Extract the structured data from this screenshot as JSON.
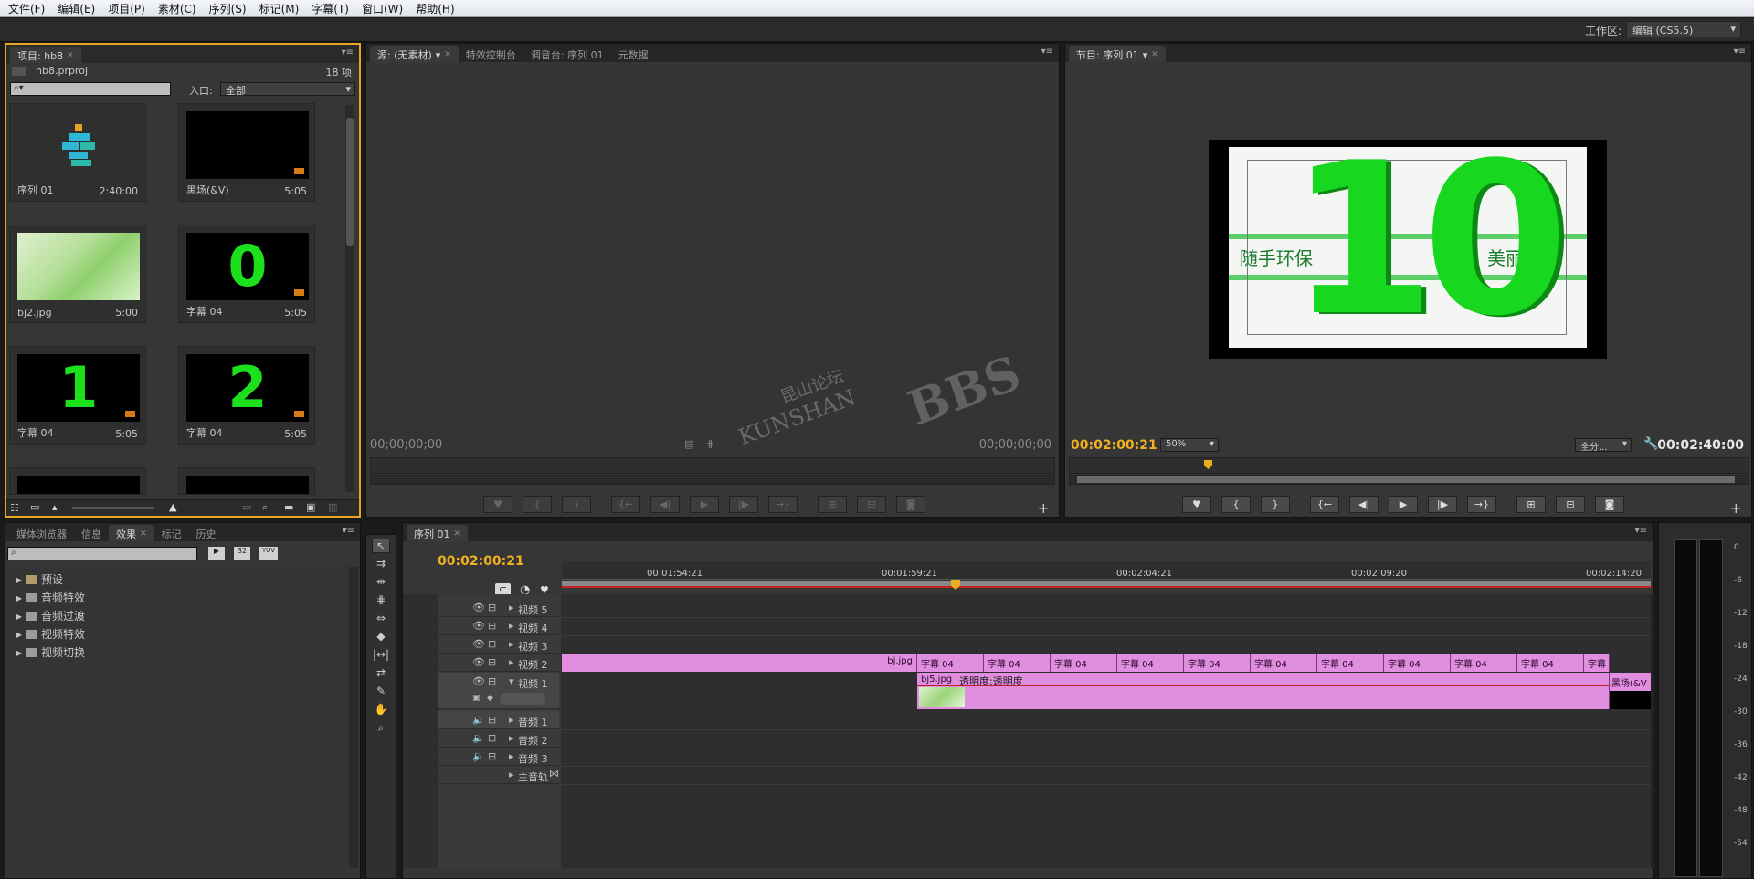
{
  "menu": [
    "文件(F)",
    "编辑(E)",
    "项目(P)",
    "素材(C)",
    "序列(S)",
    "标记(M)",
    "字幕(T)",
    "窗口(W)",
    "帮助(H)"
  ],
  "workspace": {
    "label": "工作区:",
    "value": "编辑 (CS5.5)"
  },
  "project": {
    "tab": "项目: hb8",
    "file": "hb8.prproj",
    "count": "18 项",
    "inlet_label": "入口:",
    "inlet_value": "全部",
    "items": [
      {
        "name": "序列 01",
        "duration": "2:40:00",
        "type": "sequence"
      },
      {
        "name": "黑场(&V)",
        "duration": "5:05",
        "type": "black"
      },
      {
        "name": "bj2.jpg",
        "duration": "5:00",
        "type": "image"
      },
      {
        "name": "字幕 04",
        "duration": "5:05",
        "type": "title",
        "glyph": "0"
      },
      {
        "name": "字幕 04",
        "duration": "5:05",
        "type": "title",
        "glyph": "1"
      },
      {
        "name": "字幕 04",
        "duration": "5:05",
        "type": "title",
        "glyph": "2"
      }
    ]
  },
  "source": {
    "tabs": [
      "源: (无素材)",
      "特效控制台",
      "调音台: 序列 01",
      "元数据"
    ],
    "timecode_left": "00;00;00;00",
    "timecode_right": "00;00;00;00"
  },
  "program": {
    "tab": "节目: 序列 01",
    "timecode": "00:02:00:21",
    "zoom": "50%",
    "fit": "全分...",
    "duration": "00:02:40:00",
    "preview": {
      "left_text": "随手环保",
      "number": "10",
      "right_text": "美丽昆山"
    }
  },
  "effects": {
    "tabs": [
      "媒体浏览器",
      "信息",
      "效果",
      "标记",
      "历史"
    ],
    "folders": [
      "预设",
      "音频特效",
      "音频过渡",
      "视频特效",
      "视频切换"
    ],
    "icons_text": [
      "32",
      "YUV"
    ]
  },
  "timeline": {
    "tab": "序列 01",
    "timecode": "00:02:00:21",
    "ruler": [
      "00:01:54:21",
      "00:01:59:21",
      "00:02:04:21",
      "00:02:09:20",
      "00:02:14:20"
    ],
    "video_tracks": [
      "视频 5",
      "视频 4",
      "视频 3",
      "视频 2",
      "视频 1"
    ],
    "audio_tracks": [
      "音频 1",
      "音频 2",
      "音频 3",
      "主音轨"
    ],
    "v2_clips": [
      "bj.jpg",
      "字幕 04",
      "字幕 04",
      "字幕 04",
      "字幕 04",
      "字幕 04",
      "字幕 04",
      "字幕 04",
      "字幕 04",
      "字幕 04",
      "字幕 04",
      "字幕"
    ],
    "v1_clip": "bj5.jpg",
    "v1_opacity": "透明度:透明度",
    "v1_end_clip": "黑场(&V"
  },
  "meter_labels": [
    "0",
    "-6",
    "-12",
    "-18",
    "-24",
    "-30",
    "-36",
    "-42",
    "-48",
    "-54"
  ],
  "watermark": {
    "line1": "昆山论坛",
    "line2": "KUNSHAN",
    "line3": "BBS"
  },
  "colors": {
    "accent": "#e8a326",
    "clip": "#e28ee0",
    "green": "#1de01d",
    "playhead": "#d01818"
  }
}
